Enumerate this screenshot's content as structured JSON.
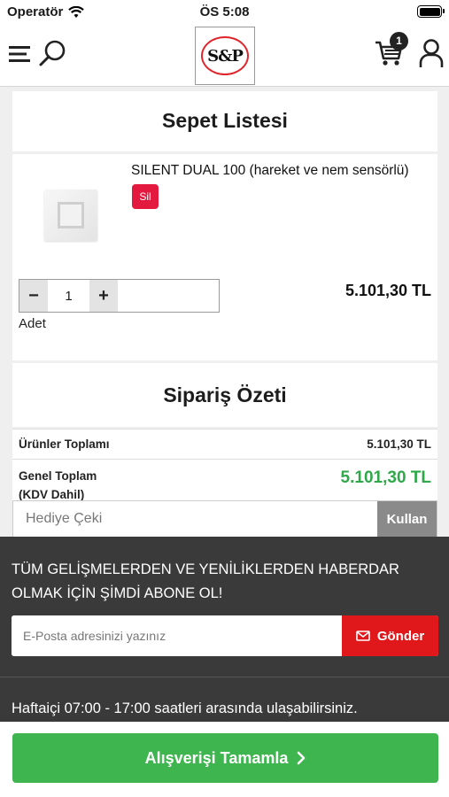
{
  "status_bar": {
    "carrier": "Operatör",
    "time": "ÖS 5:08"
  },
  "header": {
    "logo_text": "S&P",
    "cart_count": "1"
  },
  "cart": {
    "title": "Sepet Listesi",
    "item": {
      "name": "SILENT DUAL 100 (hareket ve nem sensörlü)",
      "delete_label": "Sil",
      "quantity": "1",
      "minus": "−",
      "plus": "+",
      "quantity_label": "Adet",
      "price": "5.101,30 TL"
    }
  },
  "summary": {
    "title": "Sipariş Özeti",
    "subtotal_label": "Ürünler Toplamı",
    "subtotal_value": "5.101,30 TL",
    "grand_label_line1": "Genel Toplam",
    "grand_label_line2": "(KDV Dahil)",
    "grand_value": "5.101,30 TL"
  },
  "coupon": {
    "placeholder": "Hediye Çeki",
    "button": "Kullan"
  },
  "newsletter": {
    "text": "TÜM GELİŞMELERDEN VE YENİLİKLERDEN HABERDAR OLMAK İÇİN ŞİMDİ ABONE OL!",
    "placeholder": "E-Posta adresinizi yazınız",
    "button": "Gönder"
  },
  "footer": {
    "hours": "Haftaiçi 07:00 - 17:00 saatleri arasında ulaşabilirsiniz."
  },
  "checkout": {
    "button": "Alışverişi Tamamla"
  },
  "colors": {
    "accent_green": "#3fb54f",
    "danger_red": "#e0171b",
    "delete_pink": "#e3193f",
    "footer_bg": "#3a3a3a"
  }
}
